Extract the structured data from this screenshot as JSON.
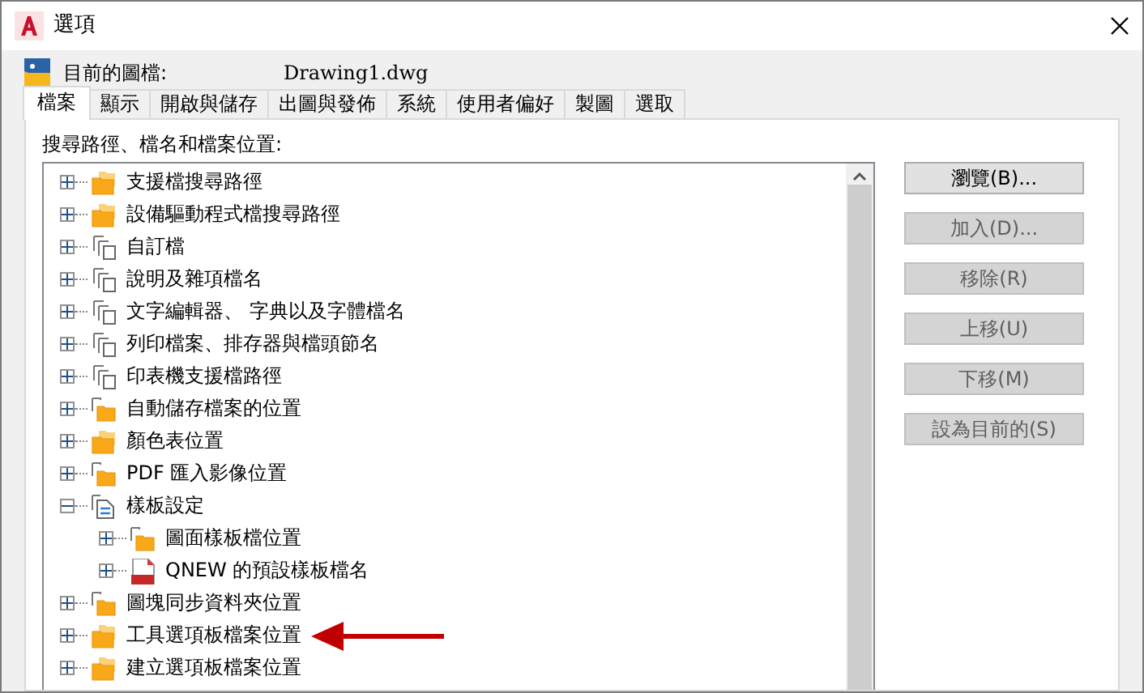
{
  "window": {
    "title": "選項"
  },
  "current_drawing": {
    "label": "目前的圖檔:",
    "value": "Drawing1.dwg"
  },
  "tabs": [
    {
      "label": "檔案",
      "selected": true
    },
    {
      "label": "顯示",
      "selected": false
    },
    {
      "label": "開啟與儲存",
      "selected": false
    },
    {
      "label": "出圖與發佈",
      "selected": false
    },
    {
      "label": "系統",
      "selected": false
    },
    {
      "label": "使用者偏好",
      "selected": false
    },
    {
      "label": "製圖",
      "selected": false
    },
    {
      "label": "選取",
      "selected": false
    }
  ],
  "tree_label": "搜尋路徑、檔名和檔案位置:",
  "tree": [
    {
      "label": "支援檔搜尋路徑",
      "kind": "folders",
      "expanded": false
    },
    {
      "label": "設備驅動程式檔搜尋路徑",
      "kind": "folders",
      "expanded": false
    },
    {
      "label": "自訂檔",
      "kind": "files",
      "expanded": false
    },
    {
      "label": "說明及雜項檔名",
      "kind": "files",
      "expanded": false
    },
    {
      "label": "文字編輯器、 字典以及字體檔名",
      "kind": "files",
      "expanded": false
    },
    {
      "label": "列印檔案、排存器與檔頭節名",
      "kind": "files",
      "expanded": false
    },
    {
      "label": "印表機支援檔路徑",
      "kind": "files",
      "expanded": false
    },
    {
      "label": "自動儲存檔案的位置",
      "kind": "location",
      "expanded": false
    },
    {
      "label": "顏色表位置",
      "kind": "folders",
      "expanded": false
    },
    {
      "label": "PDF 匯入影像位置",
      "kind": "location",
      "expanded": false
    },
    {
      "label": "樣板設定",
      "kind": "settings",
      "expanded": true,
      "children": [
        {
          "label": "圖面樣板檔位置",
          "kind": "location",
          "expanded": false
        },
        {
          "label": "QNEW 的預設樣板檔名",
          "kind": "dwt",
          "expanded": false
        }
      ]
    },
    {
      "label": "圖塊同步資料夾位置",
      "kind": "location",
      "expanded": false
    },
    {
      "label": "工具選項板檔案位置",
      "kind": "folders",
      "expanded": false
    },
    {
      "label": "建立選項板檔案位置",
      "kind": "folders",
      "expanded": false
    }
  ],
  "buttons": [
    {
      "label": "瀏覽(B)...",
      "disabled": false
    },
    {
      "label": "加入(D)...",
      "disabled": true
    },
    {
      "label": "移除(R)",
      "disabled": true
    },
    {
      "label": "上移(U)",
      "disabled": true
    },
    {
      "label": "下移(M)",
      "disabled": true
    },
    {
      "label": "設為目前的(S)",
      "disabled": true
    }
  ]
}
